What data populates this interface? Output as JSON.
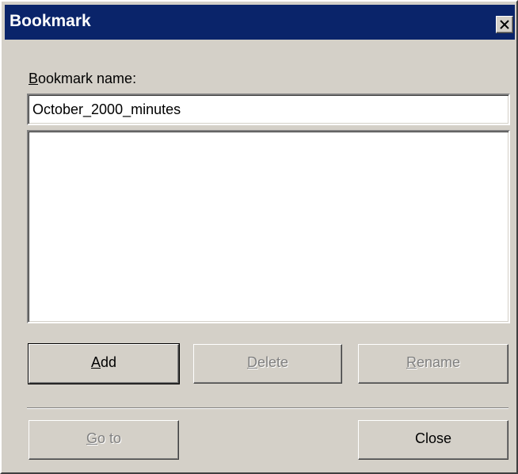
{
  "window": {
    "title": "Bookmark",
    "close_icon": "close-icon"
  },
  "form": {
    "label_accel": "B",
    "label_rest": "ookmark name:",
    "name_value": "October_2000_minutes"
  },
  "bookmarks": {
    "items": []
  },
  "buttons": {
    "add_accel": "A",
    "add_rest": "dd",
    "delete_accel": "D",
    "delete_rest": "elete",
    "rename_accel": "R",
    "rename_rest": "ename",
    "goto_accel": "G",
    "goto_rest": "o to",
    "close": "Close"
  },
  "colors": {
    "titlebar": "#0a246a",
    "face": "#d4d0c8",
    "disabled_text": "#808080"
  }
}
